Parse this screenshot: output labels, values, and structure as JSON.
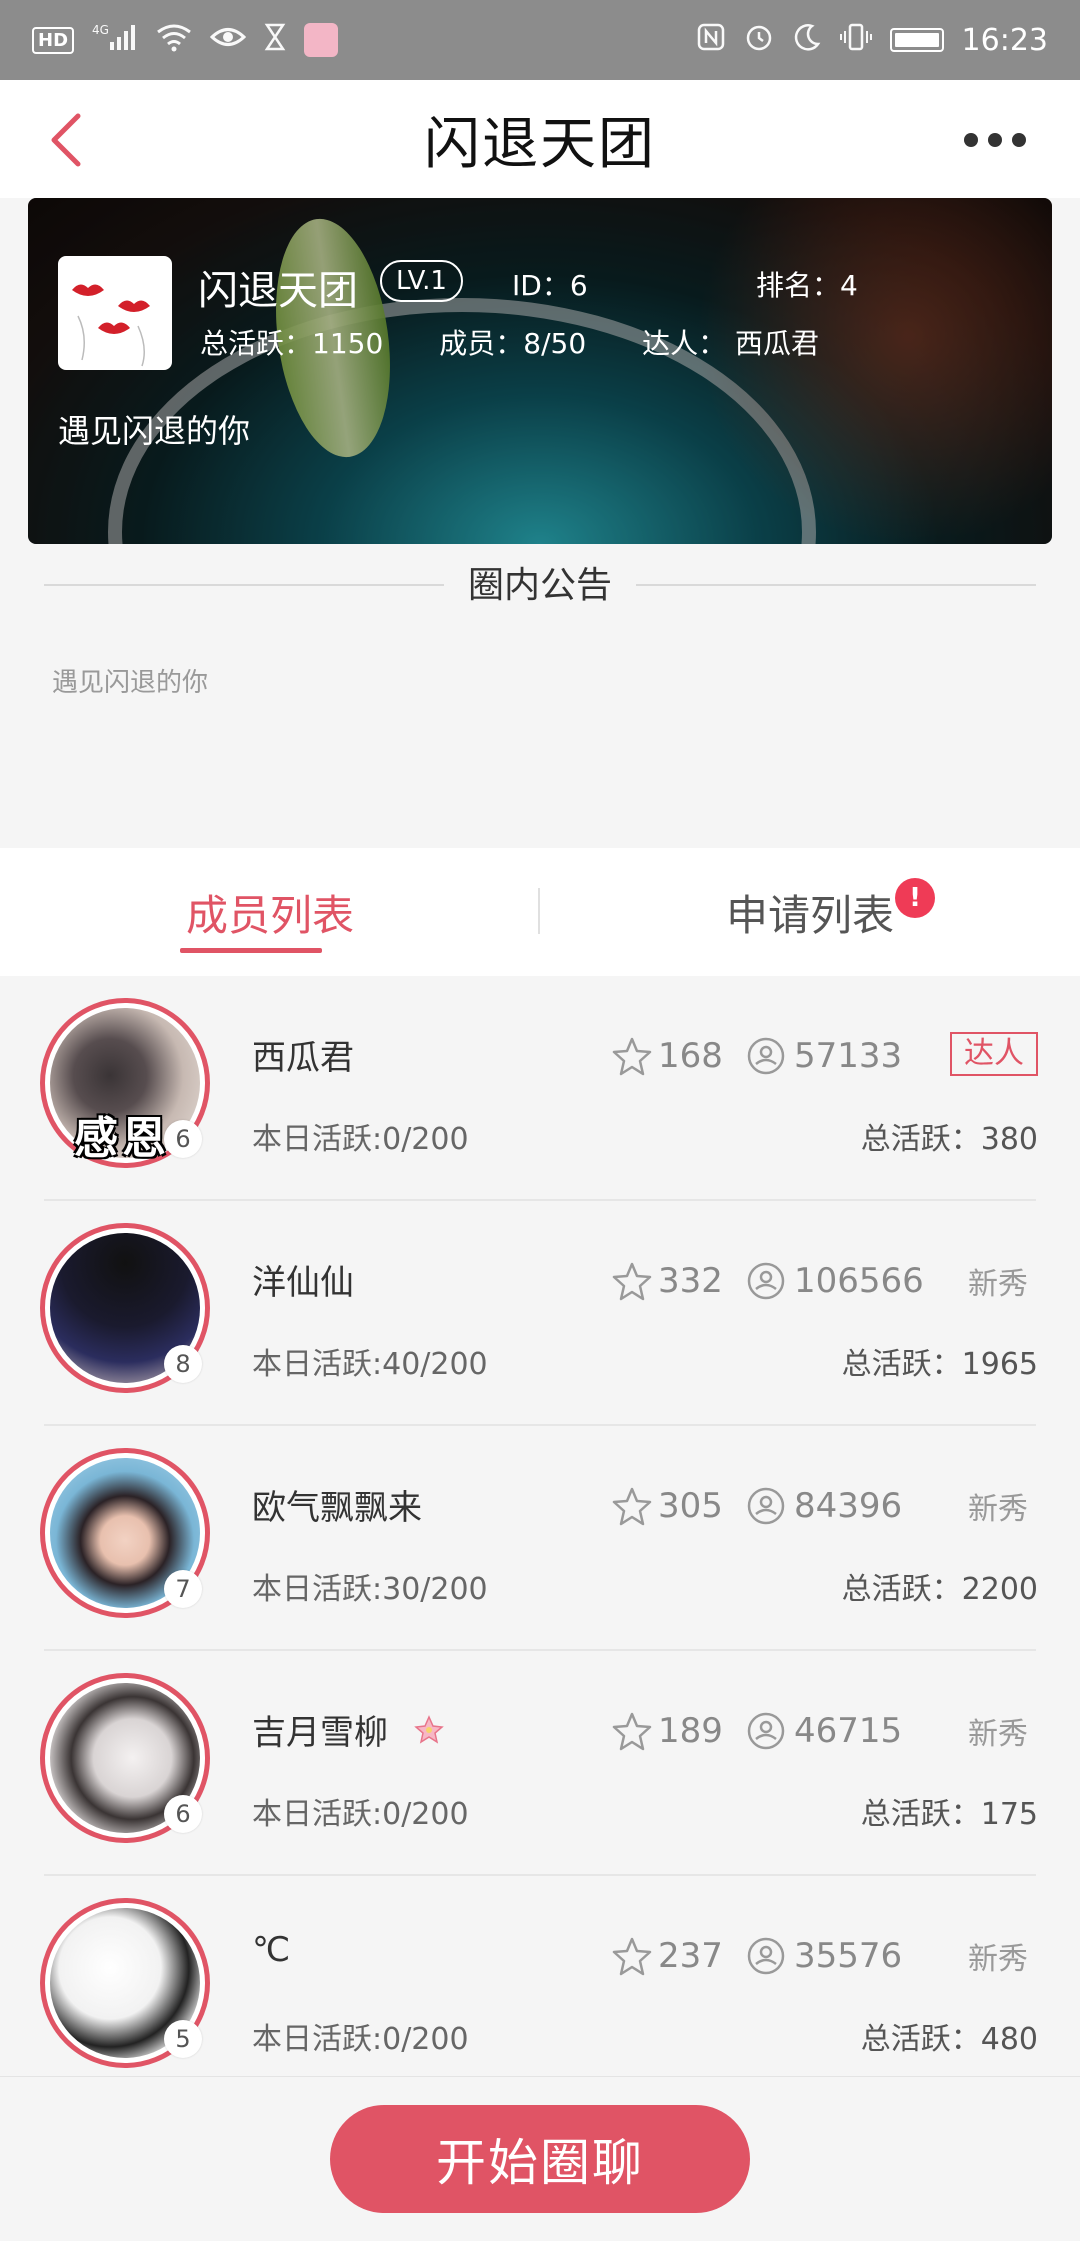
{
  "status_bar": {
    "left_icons": [
      "hd-icon",
      "signal-4g-icon",
      "wifi-icon",
      "eye-icon",
      "hourglass-icon",
      "app-avatar-icon"
    ],
    "right_icons": [
      "nfc-icon",
      "alarm-icon",
      "moon-icon",
      "vibrate-icon",
      "battery-icon"
    ],
    "hd_label": "HD",
    "network_label": "4G",
    "time": "16:23"
  },
  "header": {
    "title": "闪退天团",
    "back_icon": "chevron-left-icon",
    "more_icon": "more-dots-icon"
  },
  "group": {
    "name": "闪退天团",
    "level": "LV.1",
    "id_text": "ID：6",
    "rank_text": "排名：4",
    "total_activity": "总活跃：1150",
    "members": "成员：8/50",
    "expert": "达人： 西瓜君",
    "slogan": "遇见闪退的你"
  },
  "notice": {
    "title": "圈内公告",
    "body": "遇见闪退的你"
  },
  "tabs": {
    "members": "成员列表",
    "applications": "申请列表",
    "applications_badge": "!",
    "active": "members"
  },
  "members": [
    {
      "name": "西瓜君",
      "level": "6",
      "likes": "168",
      "fans": "57133",
      "role": "达人",
      "today": "本日活跃:0/200",
      "total": "总活跃：380",
      "overlay": "感恩"
    },
    {
      "name": "洋仙仙",
      "level": "8",
      "likes": "332",
      "fans": "106566",
      "role": "新秀",
      "today": "本日活跃:40/200",
      "total": "总活跃：1965"
    },
    {
      "name": "欧气飘飘来",
      "level": "7",
      "likes": "305",
      "fans": "84396",
      "role": "新秀",
      "today": "本日活跃:30/200",
      "total": "总活跃：2200"
    },
    {
      "name": "吉月雪柳",
      "level": "6",
      "likes": "189",
      "fans": "46715",
      "role": "新秀",
      "today": "本日活跃:0/200",
      "total": "总活跃：175"
    },
    {
      "name": "℃",
      "level": "5",
      "likes": "237",
      "fans": "35576",
      "role": "新秀",
      "today": "本日活跃:0/200",
      "total": "总活跃：480"
    }
  ],
  "bottom": {
    "start_chat": "开始圈聊"
  },
  "colors": {
    "accent": "#e05465",
    "alert": "#ef3b56",
    "status_bar": "#8c8c8c",
    "background": "#f5f5f5"
  }
}
